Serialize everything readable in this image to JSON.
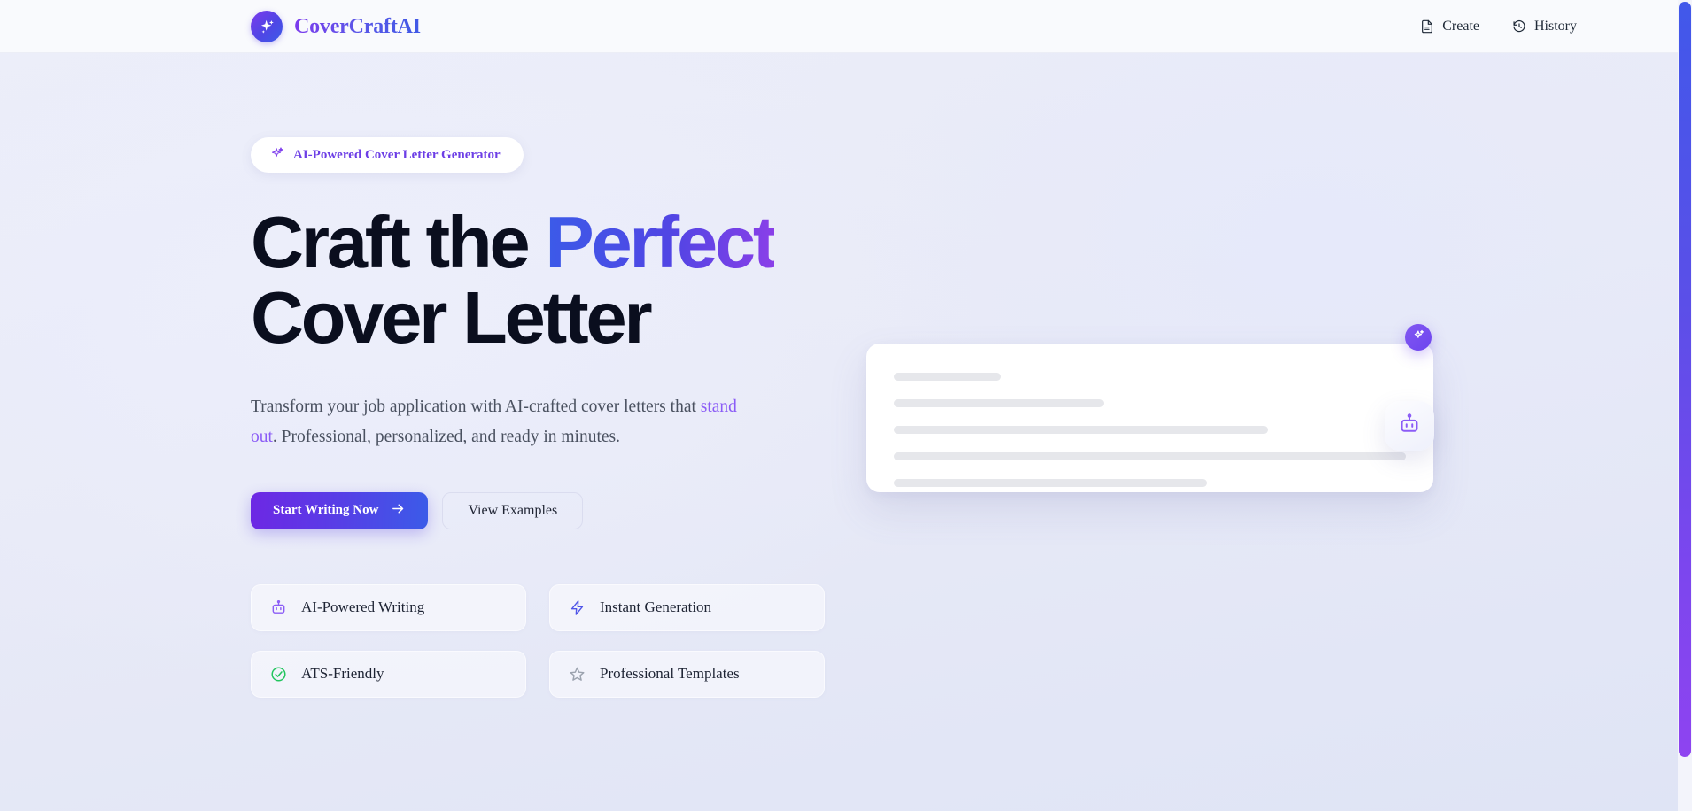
{
  "header": {
    "brand": {
      "name": "CoverCraftAI",
      "logo_icon": "sparkles-icon"
    },
    "nav": [
      {
        "label": "Create",
        "icon": "file-text-icon"
      },
      {
        "label": "History",
        "icon": "clock-rewind-icon"
      }
    ]
  },
  "hero": {
    "badge": {
      "icon": "sparkles-icon",
      "text": "AI-Powered Cover Letter Generator"
    },
    "headline": {
      "line1_plain": "Craft the ",
      "line1_accent": "Perfect",
      "line2": "Cover Letter"
    },
    "subtitle": {
      "part1": "Transform your job application with AI-crafted cover letters that ",
      "highlight": "stand out",
      "part2": ". Professional, personalized, and ready in minutes."
    },
    "cta": {
      "primary_label": "Start Writing Now",
      "primary_icon": "arrow-right-icon",
      "secondary_label": "View Examples"
    },
    "features": [
      {
        "label": "AI-Powered Writing",
        "icon": "robot-icon",
        "color": "#8b5cf6"
      },
      {
        "label": "Instant Generation",
        "icon": "lightning-icon",
        "color": "#4f55e8"
      },
      {
        "label": "ATS-Friendly",
        "icon": "check-circle-icon",
        "color": "#22c55e"
      },
      {
        "label": "Professional Templates",
        "icon": "star-icon",
        "color": "#9ca3af"
      }
    ],
    "mockup": {
      "sparkle_badge_icon": "sparkles-icon",
      "robot_badge_icon": "robot-icon",
      "skeleton_widths": [
        "21%",
        "41%",
        "73%",
        "100%",
        "61%"
      ]
    }
  },
  "colors": {
    "accent_purple": "#7c3aed",
    "accent_blue": "#3b5be8",
    "background": "#e9eaf7",
    "header_bg": "#f9fafd",
    "heading_text": "#0a0e1e",
    "body_text": "#4a5160",
    "skeleton": "#e6e7eb",
    "success_green": "#22c55e"
  },
  "scrollbar": {
    "position": "right",
    "orientation": "vertical"
  }
}
